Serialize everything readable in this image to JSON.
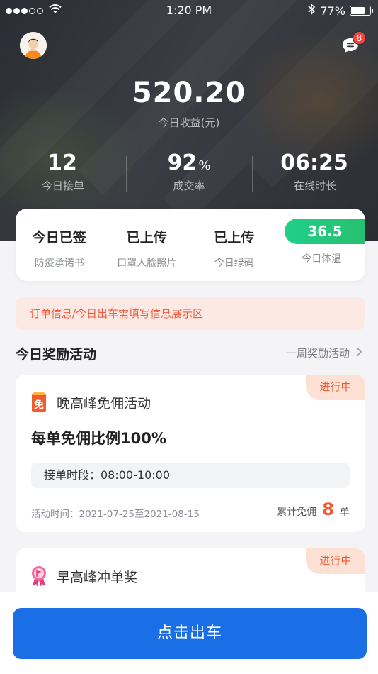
{
  "status_bar": {
    "time": "1:20 PM",
    "battery": "77%",
    "battery_level": 0.77,
    "signal_filled": 3,
    "signal_total": 5
  },
  "header": {
    "message_badge": "8",
    "earnings": {
      "value": "520.20",
      "label": "今日收益(元)"
    },
    "stats": [
      {
        "value": "12",
        "unit": "",
        "label": "今日接单"
      },
      {
        "value": "92",
        "unit": "%",
        "label": "成交率"
      },
      {
        "value": "06:25",
        "unit": "",
        "label": "在线时长"
      }
    ]
  },
  "checks": [
    {
      "value": "今日已签",
      "label": "防疫承诺书"
    },
    {
      "value": "已上传",
      "label": "口罩人脸照片"
    },
    {
      "value": "已上传",
      "label": "今日绿码"
    },
    {
      "value": "36.5",
      "label": "今日体温"
    }
  ],
  "notice": "订单信息/今日出车需填写信息展示区",
  "rewards": {
    "title": "今日奖励活动",
    "link": "一周奖励活动",
    "activities": [
      {
        "tag": "进行中",
        "icon": "commission-free-icon",
        "icon_char": "免",
        "name": "晚高峰免佣活动",
        "rule": "每单免佣比例100%",
        "period": "接单时段：08:00-10:00",
        "date": "活动时间：2021-07-25至2021-08-15",
        "count_prefix": "累计免佣",
        "count": "8",
        "count_suffix": "单"
      },
      {
        "tag": "进行中",
        "icon": "flag-medal-icon",
        "name": "早高峰冲单奖"
      }
    ]
  },
  "bottom": {
    "depart_button": "点击出车"
  },
  "colors": {
    "primary": "#1a6fe6",
    "accent": "#f05a32",
    "temp_green": "#22c97a",
    "badge_red": "#f3453b"
  }
}
